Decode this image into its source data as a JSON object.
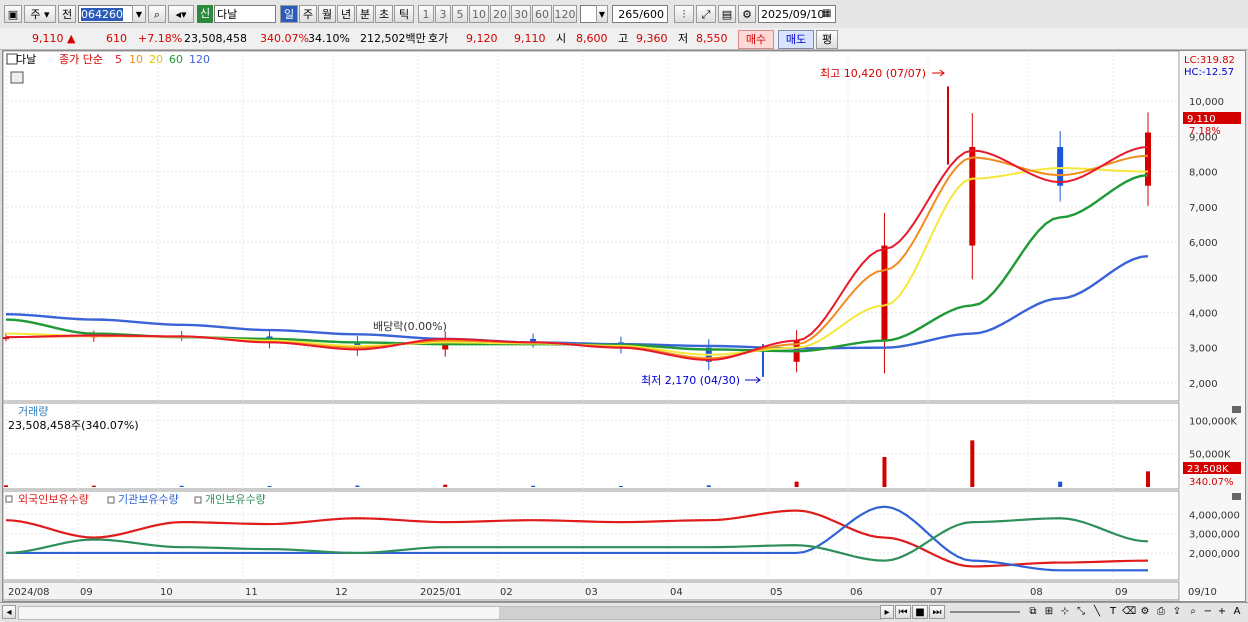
{
  "toolbar": {
    "market": "주",
    "prev_label": "전",
    "code": "064260",
    "new_badge": "신",
    "stock_name": "다날",
    "periods": [
      "일",
      "주",
      "월",
      "년",
      "분",
      "초",
      "틱"
    ],
    "active_period": "일",
    "intervals": [
      "1",
      "3",
      "5",
      "10",
      "20",
      "30",
      "60",
      "120"
    ],
    "count": "265",
    "count_max": "/600",
    "date": "2025/09/10"
  },
  "quote": {
    "price": "9,110",
    "arrow": "▲",
    "change": "610",
    "change_pct": "+7.18%",
    "volume": "23,508,458",
    "volume_pct": "340.07%",
    "turnover": "34.10%",
    "amount": "212,502백만",
    "ask_label": "호가",
    "ask1": "9,120",
    "ask2": "9,110",
    "open_label": "시",
    "open": "8,600",
    "high_label": "고",
    "high": "9,360",
    "low_label": "저",
    "low": "8,550",
    "buy_label": "매수",
    "sell_label": "매도",
    "avg_label": "평"
  },
  "legend": {
    "name": "다날",
    "indicator": "종가 단순",
    "ma5": "5",
    "ma10": "10",
    "ma20": "20",
    "ma60": "60",
    "ma120": "120"
  },
  "annotations": {
    "lc": "LC:319.82",
    "hc": "HC:-12.57",
    "high_note": "최고 10,420 (07/07)",
    "low_note": "최저 2,170 (04/30)",
    "dividend": "배당락(0.00%)",
    "last_price": "9,110",
    "last_pct": "7.18%"
  },
  "volume_panel": {
    "title": "거래량",
    "value": "23,508,458주(340.07%)",
    "last": "23,508K",
    "last_pct": "340.07%"
  },
  "holdings_panel": {
    "foreign": "외국인보유수량",
    "institution": "기관보유수량",
    "individual": "개인보유수량"
  },
  "colors": {
    "up": "#d40000",
    "down": "#1a57d6",
    "ma5": "#e8192c",
    "ma10": "#f28c1c",
    "ma20": "#f5e83a",
    "ma60": "#1f9a36",
    "ma120": "#3a63d8",
    "foreign": "#e01b1b",
    "institution": "#2f62d6",
    "individual": "#2f8f5a"
  },
  "chart_data": [
    {
      "type": "candlestick",
      "title": "다날",
      "x_ticks": [
        "2024/08",
        "09",
        "10",
        "11",
        "12",
        "2025/01",
        "02",
        "03",
        "04",
        "05",
        "06",
        "07",
        "08",
        "09",
        "09/10"
      ],
      "y_ticks": [
        2000,
        3000,
        4000,
        5000,
        6000,
        7000,
        8000,
        9000,
        10000
      ],
      "ylim": [
        1600,
        10800
      ],
      "x": [
        "2024-08",
        "2024-09",
        "2024-10",
        "2024-11",
        "2024-12",
        "2025-01",
        "2025-02",
        "2025-03",
        "2025-04",
        "2025-05",
        "2025-06",
        "2025-07",
        "2025-08",
        "2025-09"
      ],
      "close": [
        3300,
        3350,
        3320,
        3150,
        2950,
        3250,
        3150,
        3000,
        2600,
        3200,
        5900,
        8700,
        7600,
        9110
      ],
      "series": [
        {
          "name": "5",
          "values": [
            3300,
            3350,
            3320,
            3150,
            2950,
            3250,
            3150,
            3000,
            2650,
            3200,
            5800,
            8600,
            7700,
            8700
          ]
        },
        {
          "name": "10",
          "values": [
            3300,
            3330,
            3320,
            3160,
            3000,
            3200,
            3150,
            3020,
            2700,
            3100,
            5200,
            8400,
            7900,
            8450
          ]
        },
        {
          "name": "20",
          "values": [
            3400,
            3330,
            3310,
            3200,
            3050,
            3150,
            3120,
            3050,
            2800,
            3000,
            4200,
            7800,
            8100,
            8000
          ]
        },
        {
          "name": "60",
          "values": [
            3800,
            3400,
            3300,
            3250,
            3150,
            3100,
            3100,
            3080,
            2950,
            2900,
            3200,
            4200,
            6700,
            7900
          ]
        },
        {
          "name": "120",
          "values": [
            3950,
            3800,
            3650,
            3500,
            3380,
            3250,
            3150,
            3100,
            3050,
            2980,
            3000,
            3400,
            4400,
            5600
          ]
        }
      ],
      "high": {
        "value": 10420,
        "date": "07/07"
      },
      "low": {
        "value": 2170,
        "date": "04/30"
      },
      "last": 9110
    },
    {
      "type": "bar",
      "title": "거래량",
      "y_ticks": [
        "100,000K",
        "50,000K"
      ],
      "ylim": [
        0,
        120000
      ],
      "x": [
        "2024-08",
        "2024-09",
        "2024-10",
        "2024-11",
        "2024-12",
        "2025-01",
        "2025-02",
        "2025-03",
        "2025-04",
        "2025-05",
        "2025-06",
        "2025-07",
        "2025-08",
        "2025-09"
      ],
      "values": [
        2500,
        2000,
        1800,
        1500,
        2200,
        3500,
        1800,
        1500,
        2500,
        8000,
        45000,
        70000,
        8000,
        23508
      ]
    },
    {
      "type": "line",
      "y_ticks": [
        "4,000,000",
        "3,000,000",
        "2,000,000"
      ],
      "ylim": [
        700000,
        4800000
      ],
      "x": [
        "2024-08",
        "2024-09",
        "2024-10",
        "2024-11",
        "2024-12",
        "2025-01",
        "2025-02",
        "2025-03",
        "2025-04",
        "2025-05",
        "2025-06",
        "2025-07",
        "2025-08",
        "2025-09"
      ],
      "series": [
        {
          "name": "외국인보유수량",
          "values": [
            3700000,
            2800000,
            3600000,
            3500000,
            3800000,
            3600000,
            3700000,
            3600000,
            3700000,
            4200000,
            2800000,
            1300000,
            1500000,
            1600000
          ]
        },
        {
          "name": "기관보유수량",
          "values": [
            2000000,
            2000000,
            2000000,
            2000000,
            2000000,
            2000000,
            2000000,
            2000000,
            2000000,
            2000000,
            4400000,
            1600000,
            1100000,
            1100000
          ]
        },
        {
          "name": "개인보유수량",
          "values": [
            2000000,
            2700000,
            2300000,
            2200000,
            2000000,
            2300000,
            2300000,
            2300000,
            2300000,
            2400000,
            1600000,
            3600000,
            3800000,
            2600000
          ]
        }
      ]
    }
  ]
}
